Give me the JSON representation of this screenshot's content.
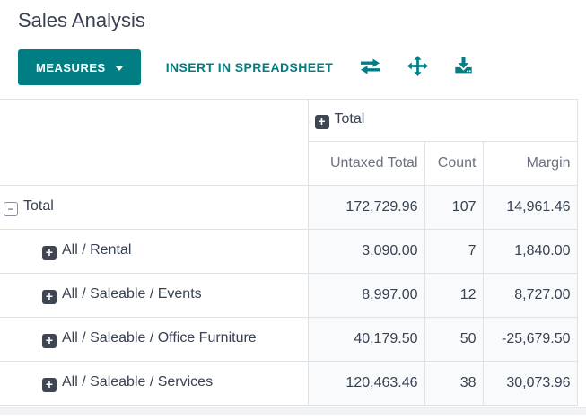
{
  "title": "Sales Analysis",
  "colors": {
    "accent": "#017e84",
    "dark_text": "#374151",
    "muted_text": "#6b7280",
    "cell_background": "#f9fafb",
    "border": "#dee2e6",
    "expand_icon_background": "#3f4652"
  },
  "toolbar": {
    "measures_label": "MEASURES",
    "insert_label": "INSERT IN SPREADSHEET",
    "icons": [
      "flip-axis-icon",
      "expand-all-icon",
      "download-icon"
    ]
  },
  "pivot": {
    "column_group": {
      "label": "Total",
      "state": "collapsed"
    },
    "measures": [
      "Untaxed Total",
      "Count",
      "Margin"
    ],
    "rows": [
      {
        "label": "Total",
        "state": "expanded",
        "indent": 0,
        "values": [
          "172,729.96",
          "107",
          "14,961.46"
        ]
      },
      {
        "label": "All / Rental",
        "state": "collapsed",
        "indent": 1,
        "values": [
          "3,090.00",
          "7",
          "1,840.00"
        ]
      },
      {
        "label": "All / Saleable / Events",
        "state": "collapsed",
        "indent": 1,
        "values": [
          "8,997.00",
          "12",
          "8,727.00"
        ]
      },
      {
        "label": "All / Saleable / Office Furniture",
        "state": "collapsed",
        "indent": 1,
        "values": [
          "40,179.50",
          "50",
          "-25,679.50"
        ]
      },
      {
        "label": "All / Saleable / Services",
        "state": "collapsed",
        "indent": 1,
        "values": [
          "120,463.46",
          "38",
          "30,073.96"
        ]
      }
    ]
  }
}
